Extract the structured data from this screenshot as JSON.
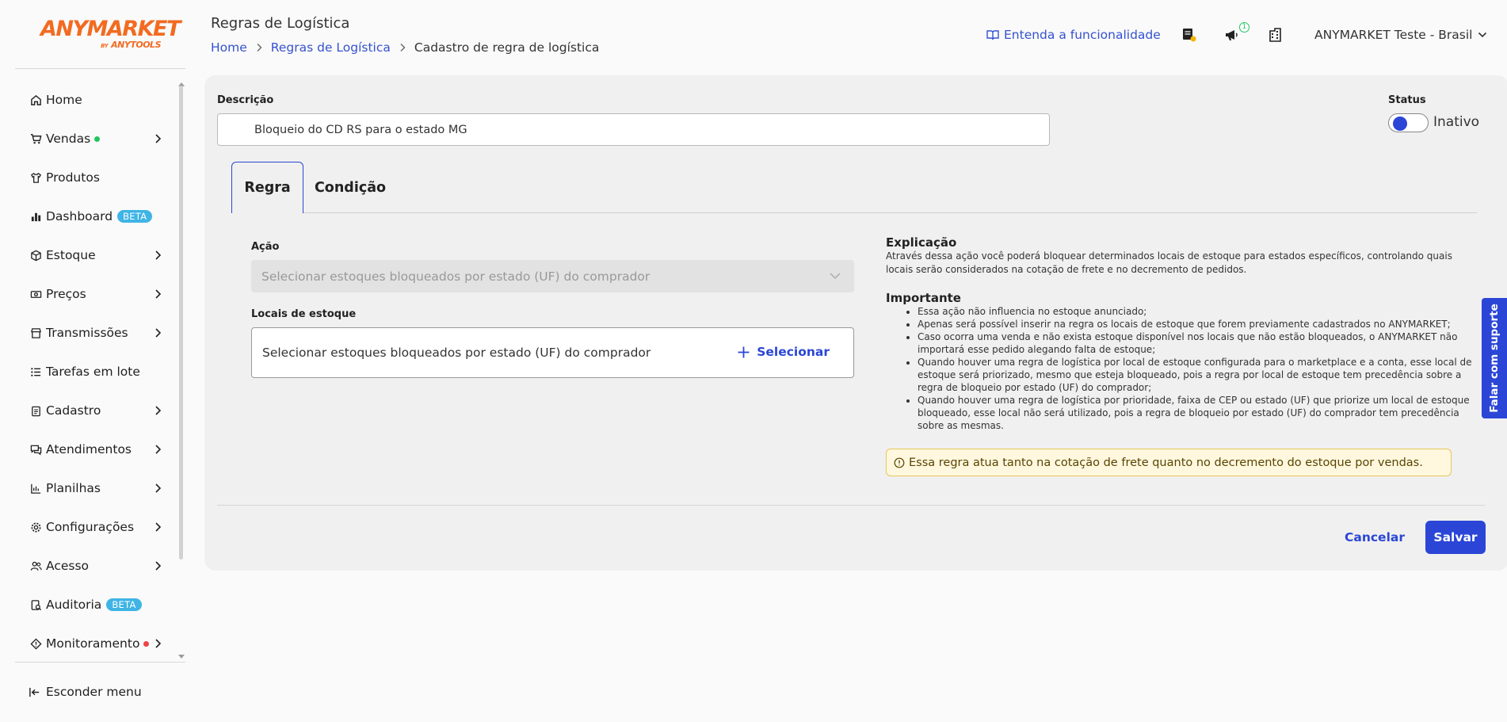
{
  "logo": {
    "main": "ANYMARKET",
    "by": "BY",
    "sub": "ANYTOOLS"
  },
  "sidebar": {
    "items": [
      {
        "label": "Home"
      },
      {
        "label": "Vendas"
      },
      {
        "label": "Produtos"
      },
      {
        "label": "Dashboard",
        "badge": "BETA"
      },
      {
        "label": "Estoque"
      },
      {
        "label": "Preços"
      },
      {
        "label": "Transmissões"
      },
      {
        "label": "Tarefas em lote"
      },
      {
        "label": "Cadastro"
      },
      {
        "label": "Atendimentos"
      },
      {
        "label": "Planilhas"
      },
      {
        "label": "Configurações"
      },
      {
        "label": "Acesso"
      },
      {
        "label": "Auditoria",
        "badge": "BETA"
      },
      {
        "label": "Monitoramento"
      }
    ],
    "hide_menu": "Esconder menu"
  },
  "header": {
    "title": "Regras de Logística",
    "breadcrumb": [
      "Home",
      "Regras de Logística",
      "Cadastro de regra de logística"
    ],
    "help_link": "Entenda a funcionalidade",
    "notification_count": "1",
    "account": "ANYMARKET Teste - Brasil"
  },
  "form": {
    "description_label": "Descrição",
    "description_value": "Bloqueio do CD RS para o estado MG",
    "status_label": "Status",
    "status_value": "Inativo",
    "tabs": [
      "Regra",
      "Condição"
    ],
    "action_label": "Ação",
    "action_placeholder": "Selecionar estoques bloqueados por estado (UF) do comprador",
    "locations_label": "Locais de estoque",
    "locations_text": "Selecionar estoques bloqueados por estado (UF) do comprador",
    "select_button": "Selecionar"
  },
  "explanation": {
    "title": "Explicação",
    "text": "Através dessa ação você poderá bloquear determinados locais de estoque para estados específicos, controlando quais locais serão considerados na cotação de frete e no decremento de pedidos.",
    "important_title": "Importante",
    "important_items": [
      "Essa ação não influencia no estoque anunciado;",
      "Apenas será possível inserir na regra os locais de estoque que forem previamente cadastrados no ANYMARKET;",
      "Caso ocorra uma venda e não exista estoque disponível nos locais que não estão bloqueados, o ANYMARKET não importará esse pedido alegando falta de estoque;",
      "Quando houver uma regra de logística por local de estoque configurada para o marketplace e a conta, esse local de estoque será priorizado, mesmo que esteja bloqueado, pois a regra por local de estoque tem precedência sobre a regra de bloqueio por estado (UF) do comprador;",
      "Quando houver uma regra de logística por prioridade, faixa de CEP ou estado (UF) que priorize um local de estoque bloqueado, esse local não será utilizado, pois a regra de bloqueio por estado (UF) do comprador tem precedência sobre as mesmas."
    ],
    "alert": "Essa regra atua tanto na cotação de frete quanto no decremento do estoque por vendas."
  },
  "footer": {
    "cancel": "Cancelar",
    "save": "Salvar"
  },
  "support_tab": "Falar com suporte",
  "colors": {
    "primary": "#2b46d6",
    "brand": "#f26b21",
    "beta": "#3fb4e5",
    "alert_bg": "#fff8df"
  }
}
